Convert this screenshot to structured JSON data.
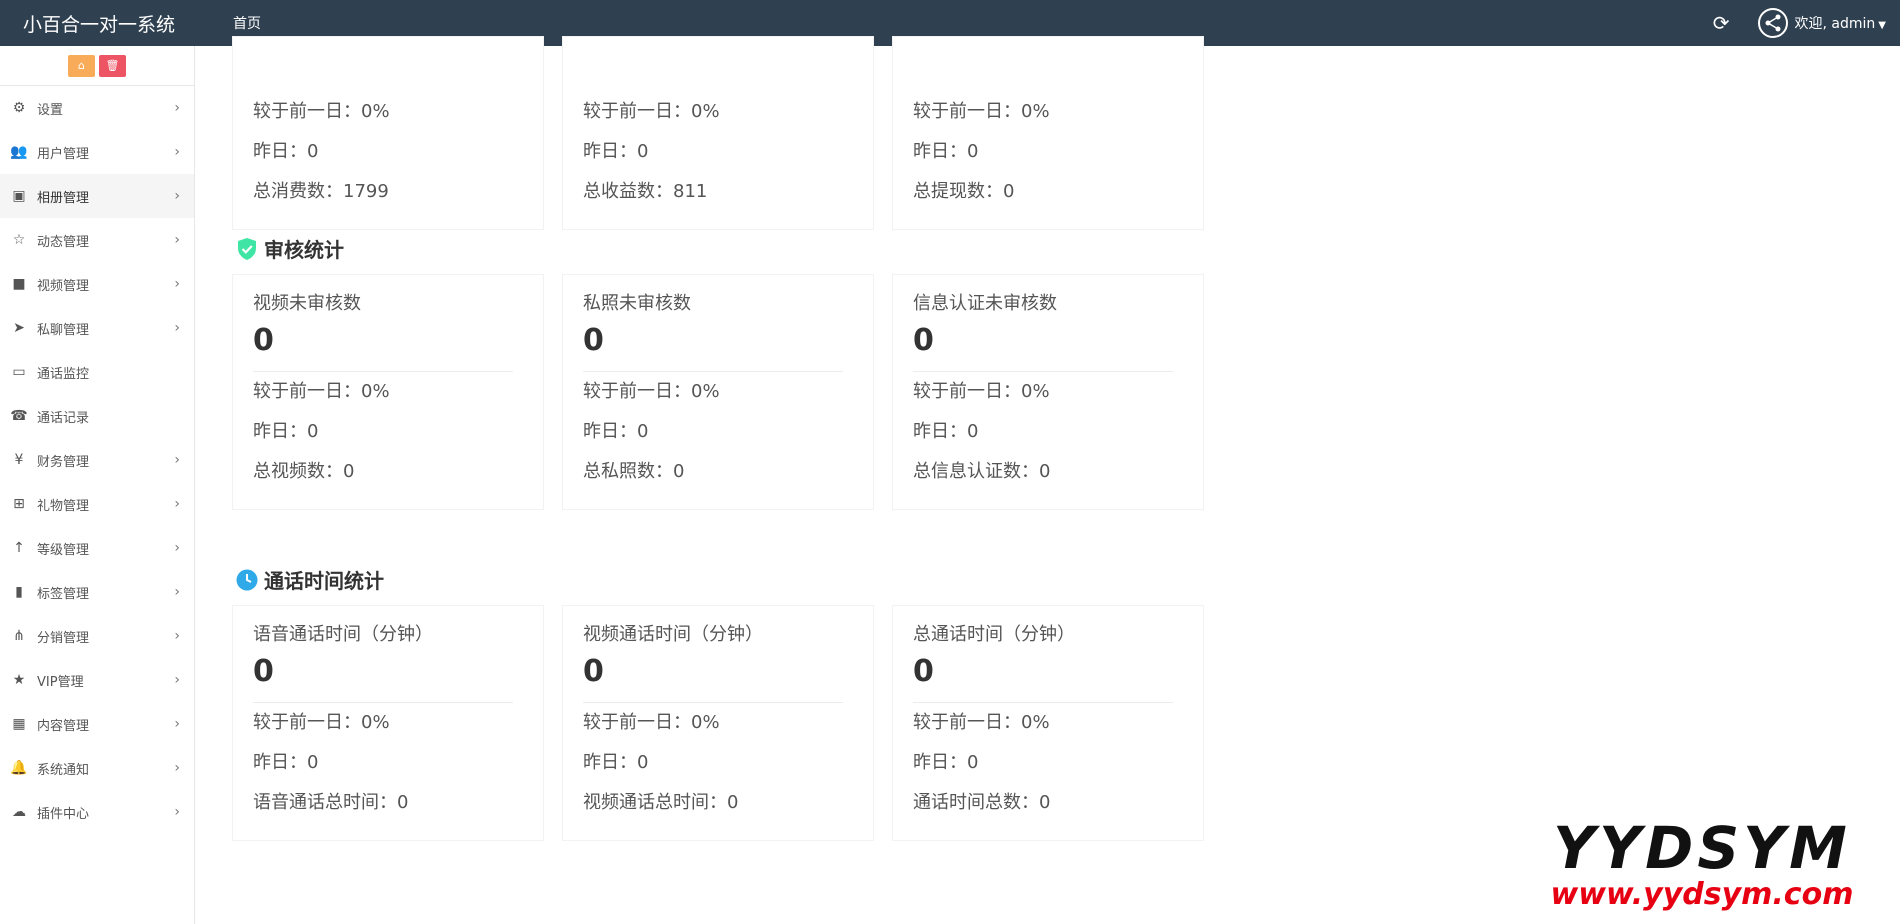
{
  "topbar": {
    "brand": "小百合一对一系统",
    "home": "首页",
    "welcome": "欢迎, admin"
  },
  "sidebar": {
    "items": [
      {
        "label": "设置",
        "icon": "gears-icon",
        "arrow": true
      },
      {
        "label": "用户管理",
        "icon": "users-icon",
        "arrow": true
      },
      {
        "label": "相册管理",
        "icon": "image-icon",
        "arrow": true,
        "active": true
      },
      {
        "label": "动态管理",
        "icon": "star-outline-icon",
        "arrow": true
      },
      {
        "label": "视频管理",
        "icon": "video-icon",
        "arrow": true
      },
      {
        "label": "私聊管理",
        "icon": "telegram-icon",
        "arrow": true
      },
      {
        "label": "通话监控",
        "icon": "monitor-icon",
        "arrow": false
      },
      {
        "label": "通话记录",
        "icon": "phone-icon",
        "arrow": false
      },
      {
        "label": "财务管理",
        "icon": "yen-icon",
        "arrow": true
      },
      {
        "label": "礼物管理",
        "icon": "gift-icon",
        "arrow": true
      },
      {
        "label": "等级管理",
        "icon": "level-icon",
        "arrow": true
      },
      {
        "label": "标签管理",
        "icon": "bookmark-icon",
        "arrow": true
      },
      {
        "label": "分销管理",
        "icon": "sitemap-icon",
        "arrow": true
      },
      {
        "label": "VIP管理",
        "icon": "star-icon",
        "arrow": true
      },
      {
        "label": "内容管理",
        "icon": "grid-icon",
        "arrow": true
      },
      {
        "label": "系统通知",
        "icon": "bell-icon",
        "arrow": true
      },
      {
        "label": "插件中心",
        "icon": "cloud-icon",
        "arrow": true
      }
    ]
  },
  "top_partial": [
    {
      "compare": "较于前一日：0%",
      "yesterday": "昨日：0",
      "total": "总消费数：1799"
    },
    {
      "compare": "较于前一日：0%",
      "yesterday": "昨日：0",
      "total": "总收益数：811"
    },
    {
      "compare": "较于前一日：0%",
      "yesterday": "昨日：0",
      "total": "总提现数：0"
    }
  ],
  "audit": {
    "title": "审核统计",
    "cards": [
      {
        "label": "视频未审核数",
        "value": "0",
        "compare": "较于前一日：0%",
        "yesterday": "昨日：0",
        "total": "总视频数：0"
      },
      {
        "label": "私照未审核数",
        "value": "0",
        "compare": "较于前一日：0%",
        "yesterday": "昨日：0",
        "total": "总私照数：0"
      },
      {
        "label": "信息认证未审核数",
        "value": "0",
        "compare": "较于前一日：0%",
        "yesterday": "昨日：0",
        "total": "总信息认证数：0"
      }
    ]
  },
  "calltime": {
    "title": "通话时间统计",
    "cards": [
      {
        "label": "语音通话时间（分钟）",
        "value": "0",
        "compare": "较于前一日：0%",
        "yesterday": "昨日：0",
        "total": "语音通话总时间：0"
      },
      {
        "label": "视频通话时间（分钟）",
        "value": "0",
        "compare": "较于前一日：0%",
        "yesterday": "昨日：0",
        "total": "视频通话总时间：0"
      },
      {
        "label": "总通话时间（分钟）",
        "value": "0",
        "compare": "较于前一日：0%",
        "yesterday": "昨日：0",
        "total": "通话时间总数：0"
      }
    ]
  },
  "watermark": {
    "logo": "YYDSYM",
    "url": "www.yydsym.com"
  },
  "colors": {
    "topbar": "#2f4050",
    "audit_icon": "#3ee5a4",
    "clock_icon": "#2fa9e8",
    "tool_orange": "#f8ac59",
    "tool_red": "#ed5565"
  }
}
